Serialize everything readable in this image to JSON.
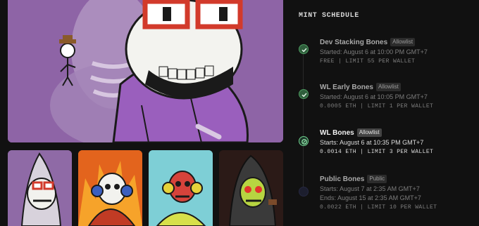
{
  "gallery": {
    "hero_alt": "featured skeleton artwork",
    "thumbnails": [
      "purple hooded skeleton",
      "flame skeleton with headphones",
      "red skull with headphones",
      "hooded skeleton with red eyes"
    ]
  },
  "schedule": {
    "title": "MINT SCHEDULE",
    "phases": [
      {
        "name": "Dev Stacking Bones",
        "badge": "Allowlist",
        "line1": "Started: August 6 at 10:00 PM GMT+7",
        "line2": "",
        "price_line": "FREE | LIMIT 55 PER WALLET",
        "status": "completed"
      },
      {
        "name": "WL Early Bones",
        "badge": "Allowlist",
        "line1": "Started: August 6 at 10:05 PM GMT+7",
        "line2": "",
        "price_line": "0.0005 ETH | LIMIT 1 PER WALLET",
        "status": "completed"
      },
      {
        "name": "WL Bones",
        "badge": "Allowlist",
        "line1": "Starts: August 6 at 10:35 PM GMT+7",
        "line2": "",
        "price_line": "0.0014 ETH | LIMIT 3 PER WALLET",
        "status": "live"
      },
      {
        "name": "Public Bones",
        "badge": "Public",
        "line1": "Starts: August 7 at 2:35 AM GMT+7",
        "line2": "Ends: August 15 at 2:35 AM GMT+7",
        "price_line": "0.0022 ETH | LIMIT 10 PER WALLET",
        "status": "upcoming"
      }
    ]
  },
  "colors": {
    "background": "#111111",
    "completed": "#4d9a60",
    "live": "#6fd08e",
    "upcoming": "#262840"
  }
}
